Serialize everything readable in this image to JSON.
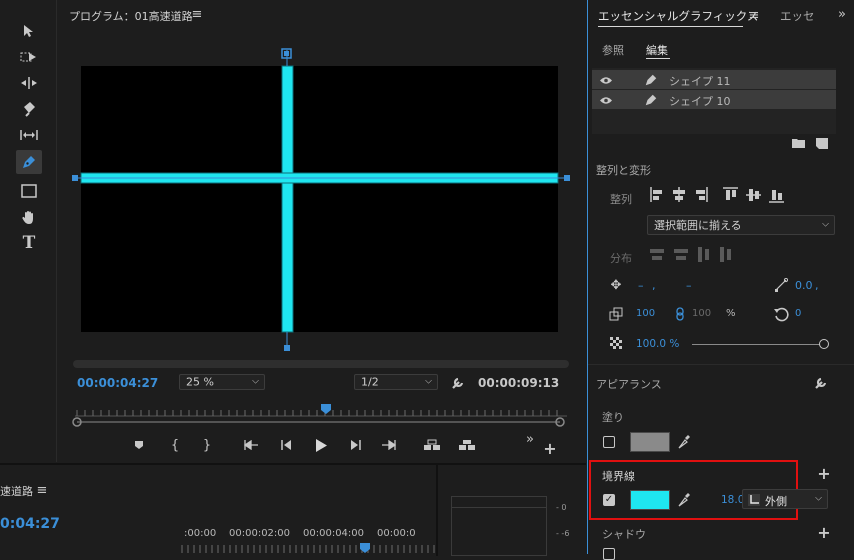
{
  "program_monitor": {
    "title": "プログラム：01高速道路",
    "menu_icon": "hamburger-icon",
    "timecode_current": "00:00:04:27",
    "timecode_total": "00:00:09:13",
    "zoom_value": "25 %",
    "resolution_value": "1/2",
    "shape_color": "#1fe6f0",
    "accent": "#3b8fd8"
  },
  "tools": [
    "selection-tool-icon",
    "track-select-tool-icon",
    "ripple-edit-tool-icon",
    "razor-tool-icon",
    "slip-tool-icon",
    "pen-tool-icon",
    "rectangle-tool-icon",
    "hand-tool-icon",
    "type-tool-icon"
  ],
  "timeline": {
    "title": "速道路",
    "timecode": "0:04:27",
    "ruler_labels": [
      ":00:00",
      "00:00:02:00",
      "00:00:04:00",
      "00:00:0"
    ]
  },
  "essential_graphics": {
    "tab_active": "エッセンシャルグラフィックス",
    "tab_other": "エッセ",
    "subtab_browse": "参照",
    "subtab_edit": "編集",
    "layers": [
      {
        "name": "シェイプ 11"
      },
      {
        "name": "シェイプ 10"
      }
    ],
    "align_section": "整列と変形",
    "align_label": "整列",
    "align_target": "選択範囲に揃える",
    "distribute_label": "分布",
    "position_x": "–",
    "position_y": "–",
    "anchor_value": "0.0",
    "scale_value": "100",
    "scale_linked": "100",
    "scale_unit": "%",
    "rotation_value": "0",
    "opacity_value": "100.0 %",
    "appearance_section": "アピアランス",
    "fill_label": "塗り",
    "fill_color": "#8a8a8a",
    "stroke_label": "境界線",
    "stroke_color": "#1fe6f0",
    "stroke_width": "18.0",
    "stroke_type": "外側",
    "shadow_label": "シャドウ",
    "highlight_color": "#e01010"
  }
}
